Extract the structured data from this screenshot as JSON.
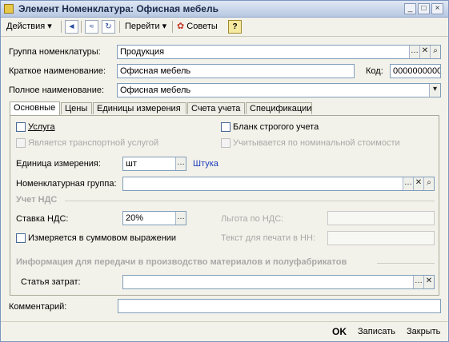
{
  "window": {
    "title": "Элемент Номенклатура: Офисная мебель",
    "controls": [
      "_",
      "□",
      "×"
    ]
  },
  "toolbar": {
    "actions_label": "Действия",
    "goto_label": "Перейти",
    "tips_label": "Советы",
    "help_label": "?"
  },
  "header": {
    "group_label": "Группа номенклатуры:",
    "group_value": "Продукция",
    "short_name_label": "Краткое наименование:",
    "short_name_value": "Офисная мебель",
    "code_label": "Код:",
    "code_value": "00000000000",
    "full_name_label": "Полное наименование:",
    "full_name_value": "Офисная мебель"
  },
  "tabs": [
    "Основные",
    "Цены",
    "Единицы измерения",
    "Счета учета",
    "Спецификации"
  ],
  "main": {
    "service_label": "Услуга",
    "transport_label": "Является транспортной услугой",
    "strict_form_label": "Бланк строгого учета",
    "nominal_label": "Учитывается по номинальной стоимости",
    "unit_label": "Единица измерения:",
    "unit_value": "шт",
    "unit_link": "Штука",
    "nomen_group_label": "Номенклатурная группа:",
    "nomen_group_value": "",
    "vat_section": "Учет НДС",
    "vat_rate_label": "Ставка НДС:",
    "vat_rate_value": "20%",
    "vat_benefit_label": "Льгота по НДС:",
    "sum_label": "Измеряется в суммовом выражении",
    "print_text_label": "Текст для печати в НН:",
    "production_section": "Информация для передачи в производство материалов и полуфабрикатов",
    "cost_item_label": "Статья затрат:",
    "cost_item_value": ""
  },
  "comment": {
    "label": "Комментарий:",
    "value": ""
  },
  "footer": {
    "ok": "OK",
    "save": "Записать",
    "close": "Закрыть"
  }
}
